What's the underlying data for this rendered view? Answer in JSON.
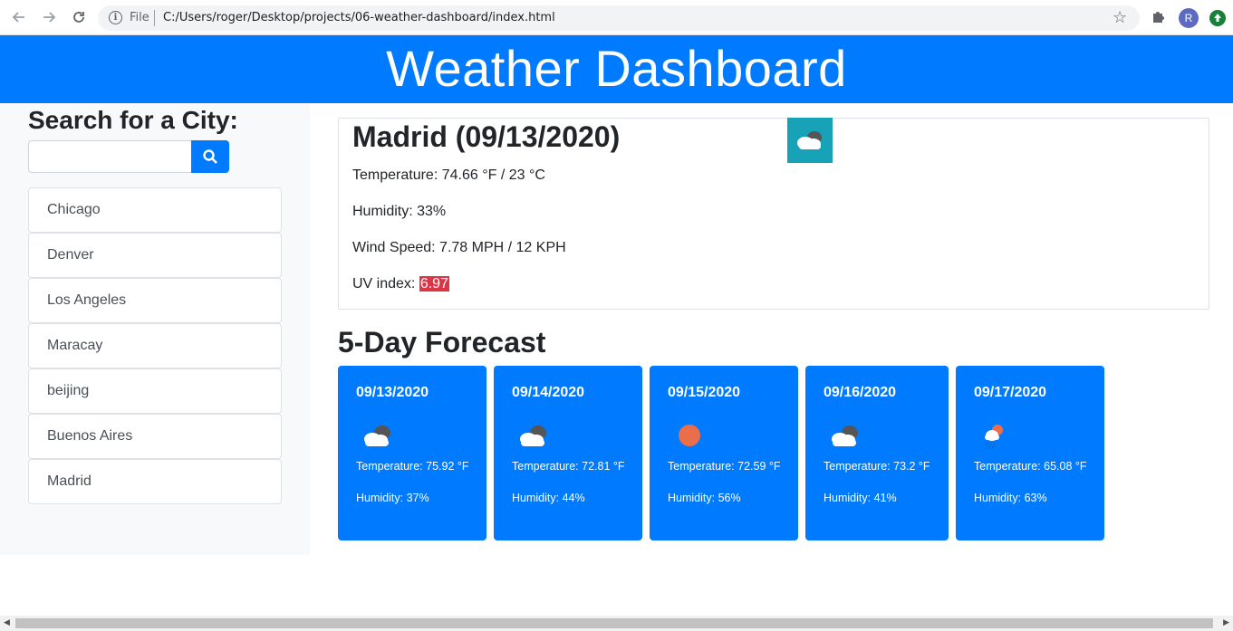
{
  "browser": {
    "file_label": "File",
    "url": "C:/Users/roger/Desktop/projects/06-weather-dashboard/index.html",
    "avatar_letter": "R"
  },
  "header": {
    "title": "Weather Dashboard"
  },
  "sidebar": {
    "search_title": "Search for a City:",
    "search_placeholder": "",
    "cities": [
      "Chicago",
      "Denver",
      "Los Angeles",
      "Maracay",
      "beijing",
      "Buenos Aires",
      "Madrid"
    ]
  },
  "current": {
    "title": "Madrid (09/13/2020)",
    "icon": "broken-clouds-icon",
    "temperature": "Temperature: 74.66 °F / 23 °C",
    "humidity": "Humidity: 33%",
    "wind": "Wind Speed: 7.78 MPH / 12 KPH",
    "uv_label": "UV index: ",
    "uv_value": "6.97",
    "uv_color": "#dc3545"
  },
  "forecast": {
    "title": "5-Day Forecast",
    "days": [
      {
        "date": "09/13/2020",
        "icon": "broken-clouds-icon",
        "temp": "Temperature: 75.92 °F",
        "humidity": "Humidity: 37%"
      },
      {
        "date": "09/14/2020",
        "icon": "broken-clouds-icon",
        "temp": "Temperature: 72.81 °F",
        "humidity": "Humidity: 44%"
      },
      {
        "date": "09/15/2020",
        "icon": "clear-sun-icon",
        "temp": "Temperature: 72.59 °F",
        "humidity": "Humidity: 56%"
      },
      {
        "date": "09/16/2020",
        "icon": "broken-clouds-icon",
        "temp": "Temperature: 73.2 °F",
        "humidity": "Humidity: 41%"
      },
      {
        "date": "09/17/2020",
        "icon": "rain-sun-icon",
        "temp": "Temperature: 65.08 °F",
        "humidity": "Humidity: 63%"
      }
    ]
  },
  "colors": {
    "primary": "#007bff",
    "info": "#17a2b8",
    "danger": "#dc3545",
    "sidebar_bg": "#f8f9fa"
  }
}
